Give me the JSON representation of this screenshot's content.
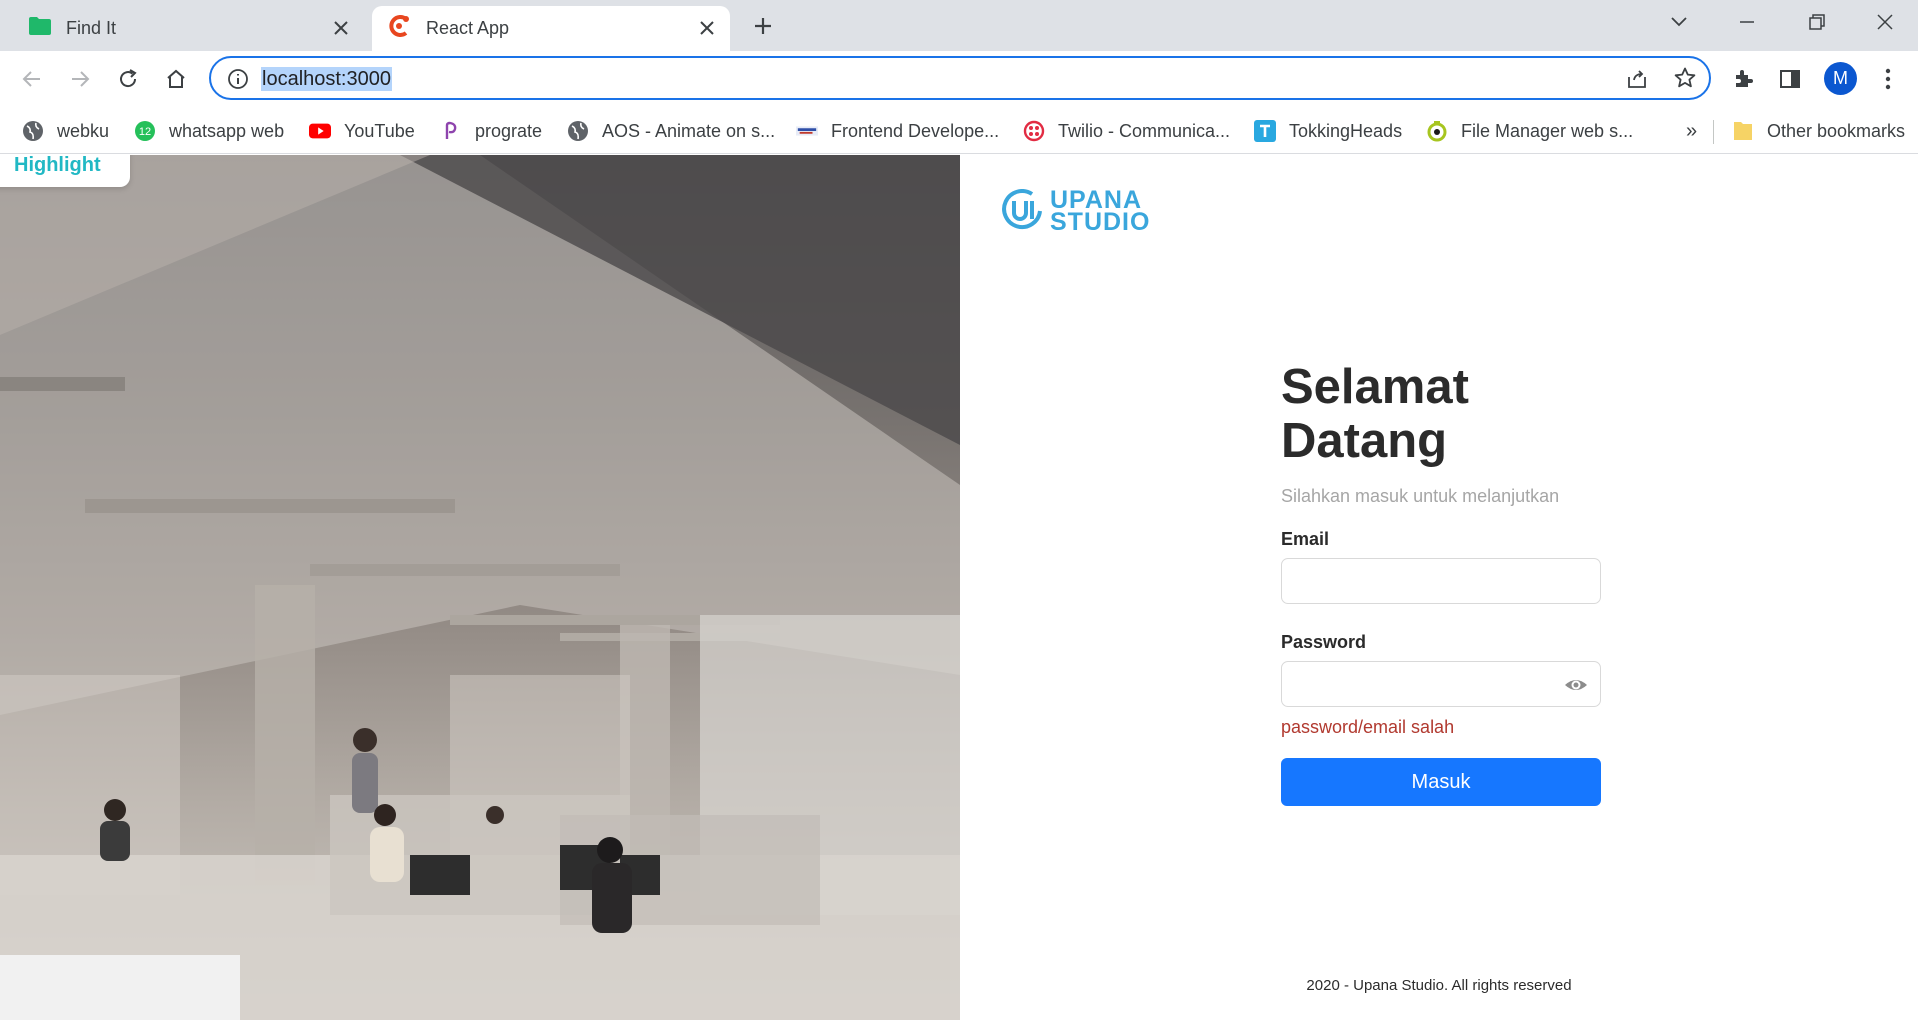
{
  "browser": {
    "tabs": [
      {
        "title": "Find It",
        "active": false,
        "icon": "folder-icon"
      },
      {
        "title": "React App",
        "active": true,
        "icon": "react-app-icon"
      }
    ],
    "address": "localhost:3000",
    "profile_initial": "M",
    "bookmarks": [
      {
        "label": "webku",
        "icon": "globe-icon"
      },
      {
        "label": "whatsapp web",
        "icon": "whatsapp-icon",
        "badge": "12"
      },
      {
        "label": "YouTube",
        "icon": "youtube-icon"
      },
      {
        "label": "prograte",
        "icon": "prograte-icon"
      },
      {
        "label": "AOS - Animate on s...",
        "icon": "globe-icon"
      },
      {
        "label": "Frontend Develope...",
        "icon": "site-icon"
      },
      {
        "label": "Twilio - Communica...",
        "icon": "twilio-icon"
      },
      {
        "label": "TokkingHeads",
        "icon": "tokkingheads-icon"
      },
      {
        "label": "File Manager web s...",
        "icon": "file-manager-icon"
      }
    ],
    "bookmarks_overflow": "»",
    "other_bookmarks": "Other bookmarks"
  },
  "page": {
    "highlight_chip": "Highlight",
    "logo": {
      "line1": "UPANA",
      "line2": "STUDIO"
    },
    "heading_line1": "Selamat",
    "heading_line2": "Datang",
    "subtitle": "Silahkan masuk untuk melanjutkan",
    "email_label": "Email",
    "email_value": "",
    "password_label": "Password",
    "password_value": "",
    "error_message": "password/email salah",
    "submit_label": "Masuk",
    "footer": "2020 - Upana Studio. All rights reserved"
  },
  "colors": {
    "primary_button": "#1677ff",
    "error": "#b1392f",
    "logo": "#3aa6dc",
    "highlight": "#21b8c4"
  }
}
